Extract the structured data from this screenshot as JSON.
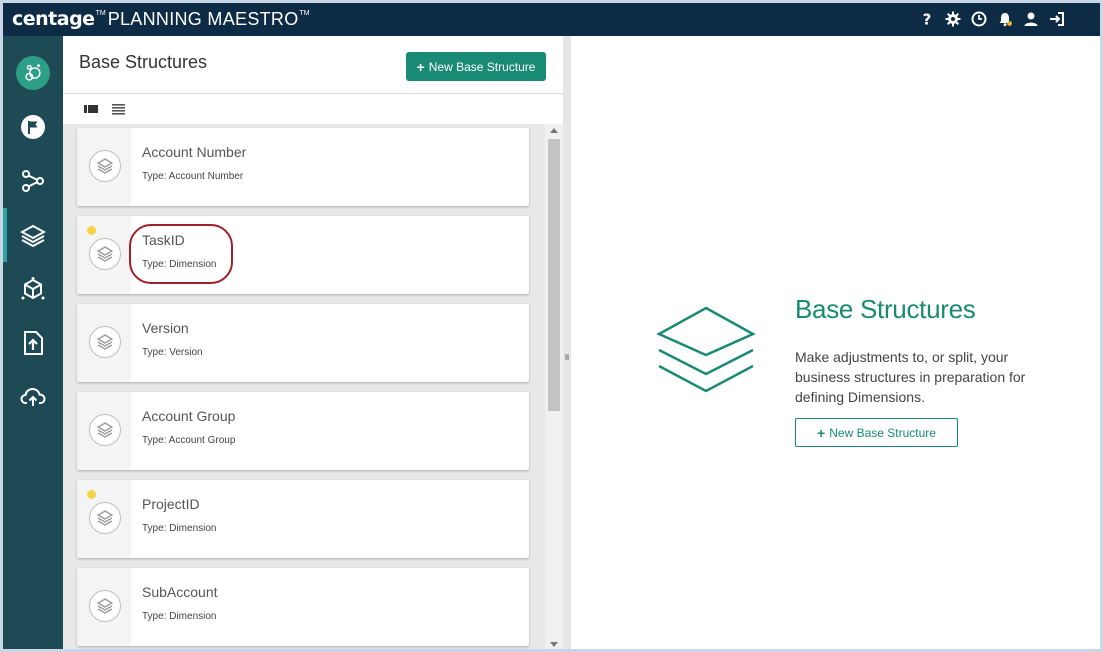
{
  "app": {
    "brand_main": "centage",
    "brand_tm1": "TM",
    "brand_product": "PLANNING MAESTRO",
    "brand_tm2": "TM"
  },
  "topbar": {
    "icons": [
      "help-icon",
      "gear-icon",
      "clock-icon",
      "bell-icon",
      "user-icon",
      "logout-icon"
    ]
  },
  "sidebar": {
    "items": [
      "logo-icon",
      "flag-icon",
      "network-icon",
      "layers-icon",
      "cube-icon",
      "upload-file-icon",
      "cloud-upload-icon"
    ],
    "active_index": 3
  },
  "list": {
    "title": "Base Structures",
    "new_button_plus": "+",
    "new_button_label": "New Base Structure",
    "cards": [
      {
        "name": "Account Number",
        "type": "Type: Account Number",
        "dot": false
      },
      {
        "name": "TaskID",
        "type": "Type: Dimension",
        "dot": true,
        "highlighted": true
      },
      {
        "name": "Version",
        "type": "Type: Version",
        "dot": false
      },
      {
        "name": "Account Group",
        "type": "Type: Account Group",
        "dot": false
      },
      {
        "name": "ProjectID",
        "type": "Type: Dimension",
        "dot": true
      },
      {
        "name": "SubAccount",
        "type": "Type: Dimension",
        "dot": false
      }
    ],
    "colors": {
      "dot": "#f5d44a",
      "highlight": "#a0202a"
    }
  },
  "detail": {
    "title": "Base Structures",
    "description": "Make adjustments to, or split, your business structures in preparation for defining Dimensions.",
    "button_plus": "+",
    "button_label": "New Base Structure"
  },
  "theme": {
    "topbar": "#0d2b45",
    "sidebar": "#1e4a56",
    "accent": "#198a73"
  }
}
